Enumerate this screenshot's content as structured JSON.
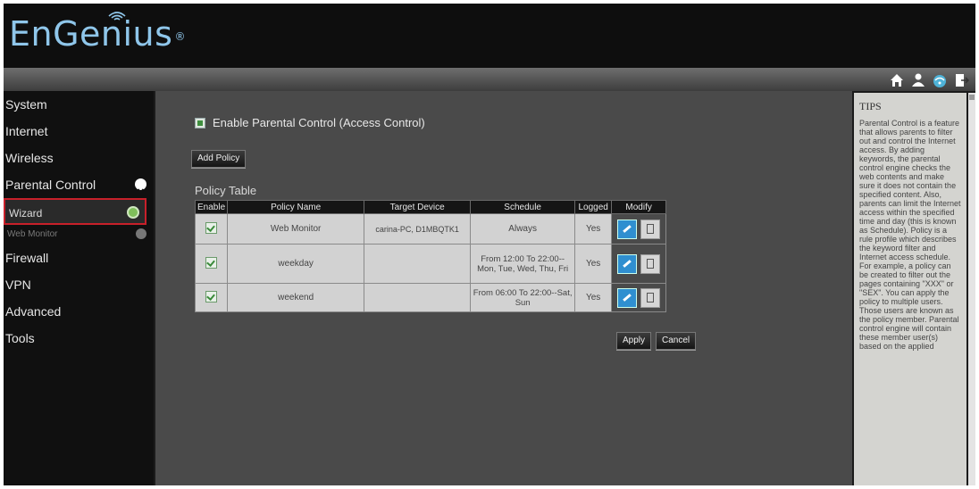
{
  "header": {
    "brand": "EnGenius",
    "brand_mark": "®"
  },
  "toolbar_icons": [
    {
      "icon": "home-icon",
      "color": "#ffffff"
    },
    {
      "icon": "user-icon",
      "color": "#ffffff"
    },
    {
      "icon": "wireless-icon",
      "color": "#4fb3d8"
    },
    {
      "icon": "logout-icon",
      "color": "#ffffff"
    }
  ],
  "sidebar": {
    "items": [
      {
        "label": "System"
      },
      {
        "label": "Internet"
      },
      {
        "label": "Wireless"
      },
      {
        "label": "Parental Control"
      },
      {
        "label": "Wizard"
      },
      {
        "label": "Web Monitor"
      },
      {
        "label": "Firewall"
      },
      {
        "label": "VPN"
      },
      {
        "label": "Advanced"
      },
      {
        "label": "Tools"
      }
    ]
  },
  "main": {
    "enable_label": "Enable Parental Control (Access Control)",
    "enable_checked": true,
    "add_policy_label": "Add Policy",
    "policy_table_title": "Policy Table",
    "columns": [
      "Enable",
      "Policy Name",
      "Target Device",
      "Schedule",
      "Logged",
      "Modify"
    ],
    "rows": [
      {
        "enabled": true,
        "name": "Web Monitor",
        "device": "carina-PC, D1MBQTK1",
        "schedule": "Always",
        "logged": "Yes"
      },
      {
        "enabled": true,
        "name": "weekday",
        "device": "",
        "schedule": "From 12:00 To 22:00--Mon, Tue, Wed, Thu, Fri",
        "logged": "Yes"
      },
      {
        "enabled": true,
        "name": "weekend",
        "device": "",
        "schedule": "From 06:00 To 22:00--Sat, Sun",
        "logged": "Yes"
      }
    ],
    "apply_label": "Apply",
    "cancel_label": "Cancel"
  },
  "tips": {
    "title": "TIPS",
    "body": "Parental Control is a feature that allows parents to filter out and control the Internet access. By adding keywords, the parental control engine checks the web contents and make sure it does not contain the specified content. Also, parents can limit the Internet access within the specified time and day (this is known as Schedule). Policy is a rule profile which describes the keyword filter and Internet access schedule. For example, a policy can be created to filter out the pages containing \"XXX\" or \"SEX\". You can apply the policy to multiple users. Those users are known as the policy member. Parental control engine will contain these member user(s) based on the applied"
  },
  "colors": {
    "accent": "#8fc6ea",
    "highlight_border": "#c8202a",
    "bullet_green": "#7fbf5a"
  }
}
